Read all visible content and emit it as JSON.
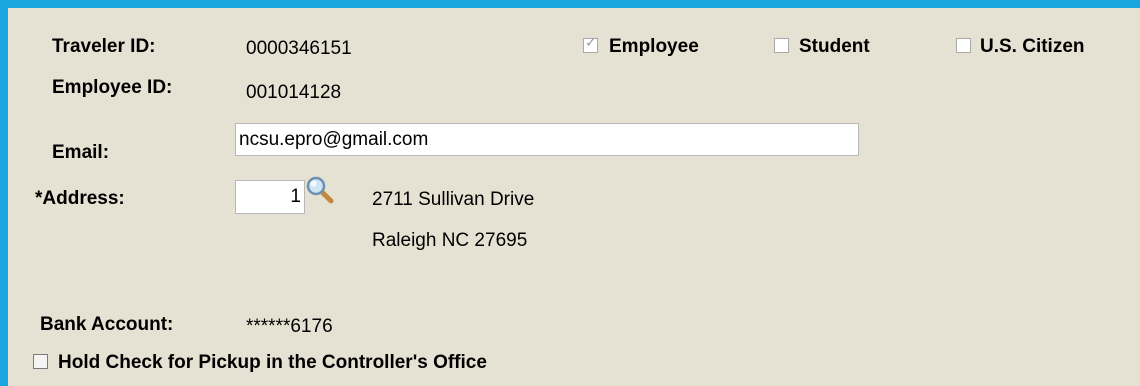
{
  "traveler": {
    "traveler_id_label": "Traveler ID:",
    "traveler_id_value": "0000346151",
    "employee_id_label": "Employee ID:",
    "employee_id_value": "001014128"
  },
  "flags": {
    "employee": {
      "label": "Employee",
      "checked": true
    },
    "student": {
      "label": "Student",
      "checked": false
    },
    "us_citizen": {
      "label": "U.S. Citizen",
      "checked": false
    }
  },
  "email": {
    "label": "Email:",
    "value": "ncsu.epro@gmail.com"
  },
  "address": {
    "label": "*Address:",
    "number": "1",
    "line1": "2711 Sullivan Drive",
    "line2": "Raleigh NC 27695"
  },
  "bank": {
    "label": "Bank Account:",
    "value": "******6176"
  },
  "hold_check": {
    "label": "Hold Check for Pickup in the Controller's Office",
    "checked": false
  },
  "icons": {
    "lookup": "magnifier-icon"
  },
  "colors": {
    "frame": "#1aa7e0",
    "panel": "#e6e2d3"
  }
}
